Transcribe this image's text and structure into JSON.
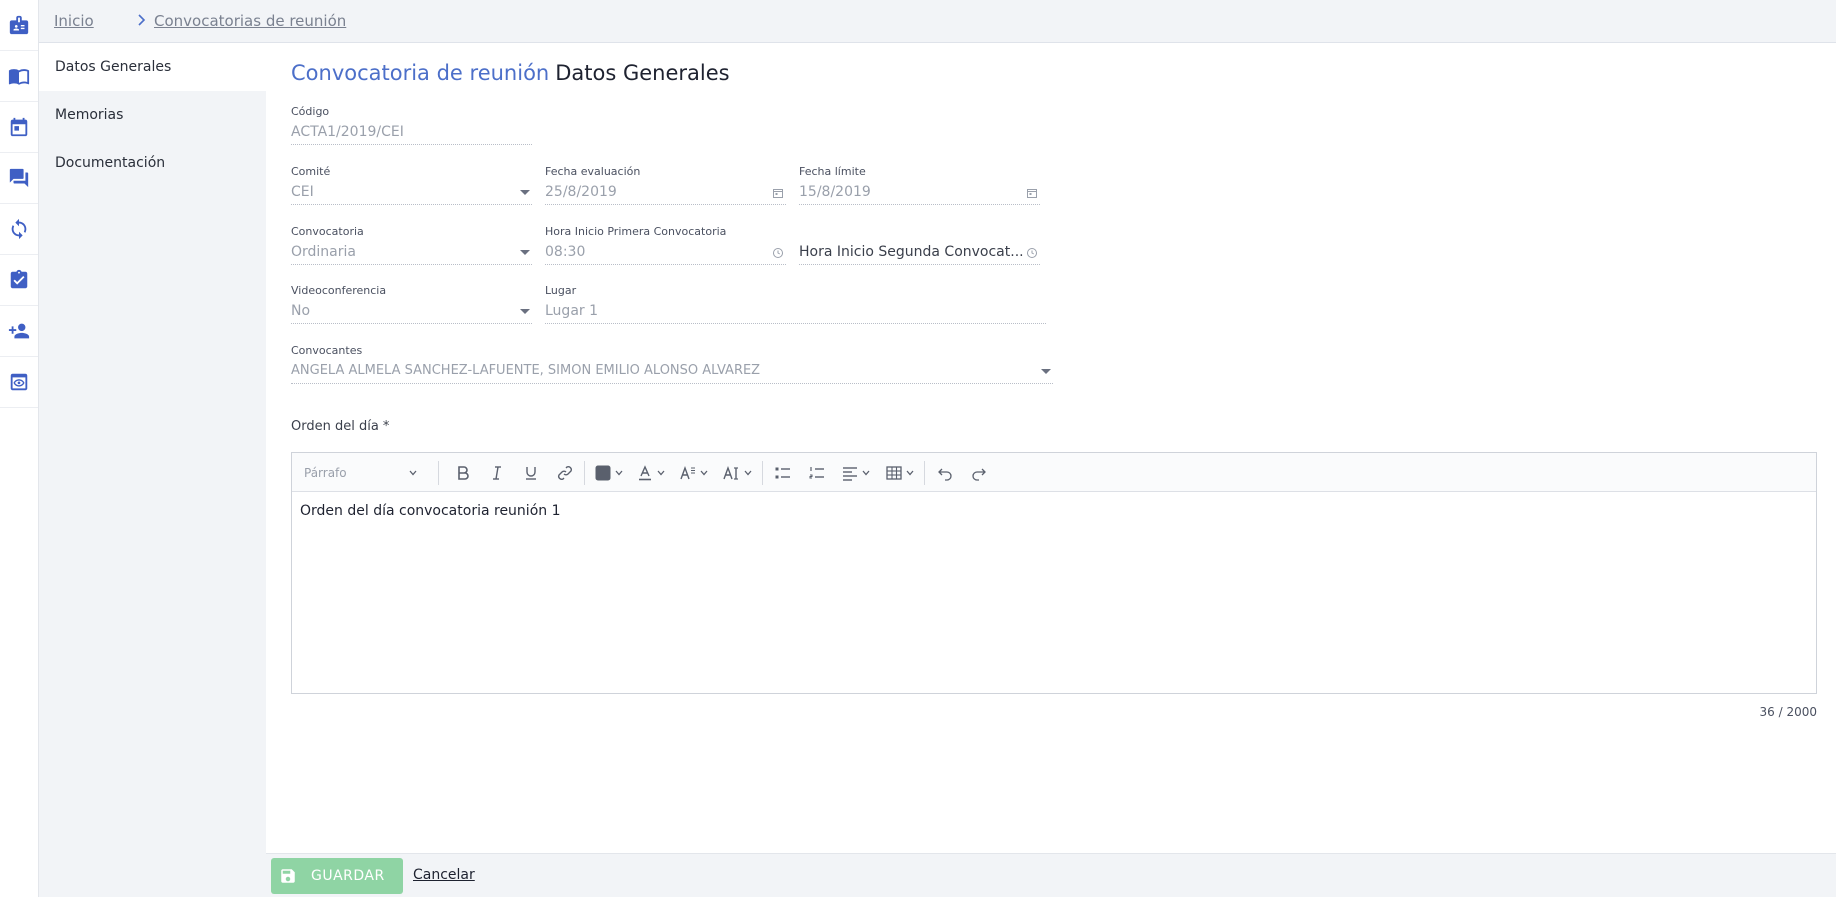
{
  "rail": {
    "items": [
      {
        "icon": "badge-icon"
      },
      {
        "icon": "book-icon"
      },
      {
        "icon": "calendar-icon"
      },
      {
        "icon": "chat-icon"
      },
      {
        "icon": "sync-icon"
      },
      {
        "icon": "clipboard-check-icon"
      },
      {
        "icon": "add-user-icon"
      },
      {
        "icon": "eye-icon"
      }
    ],
    "accent": "#3f5fc4"
  },
  "breadcrumb": {
    "home": "Inicio",
    "current": "Convocatorias de reunión"
  },
  "subnav": {
    "items": [
      {
        "label": "Datos Generales",
        "active": true
      },
      {
        "label": "Memorias",
        "active": false
      },
      {
        "label": "Documentación",
        "active": false
      }
    ]
  },
  "title": {
    "entity": "Convocatoria de reunión",
    "section": "Datos Generales"
  },
  "form": {
    "codigo": {
      "label": "Código",
      "value": "ACTA1/2019/CEI"
    },
    "comite": {
      "label": "Comité",
      "value": "CEI"
    },
    "fecha_evaluacion": {
      "label": "Fecha evaluación",
      "value": "25/8/2019"
    },
    "fecha_limite": {
      "label": "Fecha límite",
      "value": "15/8/2019"
    },
    "convocatoria": {
      "label": "Convocatoria",
      "value": "Ordinaria"
    },
    "hora_primera": {
      "label": "Hora Inicio Primera Convocatoria",
      "value": "08:30"
    },
    "hora_segunda": {
      "placeholder": "Hora Inicio Segunda Convocat..."
    },
    "videoconferencia": {
      "label": "Videoconferencia",
      "value": "No"
    },
    "lugar": {
      "label": "Lugar",
      "value": "Lugar 1"
    },
    "convocantes": {
      "label": "Convocantes",
      "value": "ANGELA ALMELA SANCHEZ-LAFUENTE, SIMON EMILIO ALONSO ALVAREZ"
    }
  },
  "orden": {
    "label": "Orden del día *",
    "paragraph_select": "Párrafo",
    "content": "Orden del día convocatoria reunión 1",
    "counter": "36 / 2000"
  },
  "footer": {
    "save_label": "GUARDAR",
    "cancel_label": "Cancelar",
    "save_color": "#8fd4a4"
  }
}
